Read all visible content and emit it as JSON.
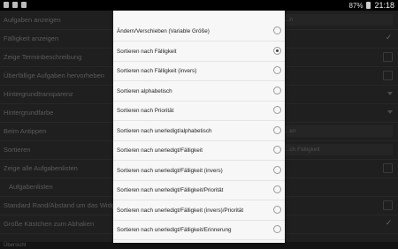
{
  "statusbar": {
    "battery": "87%",
    "time": "21:18"
  },
  "settings_rows": [
    {
      "label": "Aufgaben anzeigen",
      "control": "field",
      "field_value": "...n"
    },
    {
      "label": "Fälligkeit anzeigen",
      "control": "check_on"
    },
    {
      "label": "Zeige Terminbeschreibung",
      "control": "check"
    },
    {
      "label": "Überfällige Aufgaben hervorheben",
      "control": "check"
    },
    {
      "label": "Hintergrundtransparenz",
      "control": "dropdown"
    },
    {
      "label": "Hintergrundfarbe",
      "control": "dropdown"
    },
    {
      "label": "Beim Antippen",
      "control": "field",
      "field_value": "...en"
    },
    {
      "label": "Sortieren",
      "control": "field",
      "field_value": "...ch Fälligkeit"
    },
    {
      "label": "Zeige alle Aufgabenlisten",
      "control": "check"
    },
    {
      "label": "Aufgabenlisten",
      "control": "none"
    },
    {
      "label": "Standard Rand/Abstand um das Widget heru...",
      "control": "check"
    },
    {
      "label": "Große Kästchen zum Abhaken",
      "control": "check_on"
    }
  ],
  "footer_text": "Übersicht",
  "dialog": {
    "options": [
      {
        "label": "Ändern/Verschieben (Variable Größe)",
        "selected": false
      },
      {
        "label": "Sortieren nach Fälligkeit",
        "selected": true
      },
      {
        "label": "Sortieren nach Fälligkeit (invers)",
        "selected": false
      },
      {
        "label": "Sortieren alphabetisch",
        "selected": false
      },
      {
        "label": "Sortieren nach Priorität",
        "selected": false
      },
      {
        "label": "Sortieren nach unerledigt/alphabetisch",
        "selected": false
      },
      {
        "label": "Sortieren nach unerledigt/Fälligkeit",
        "selected": false
      },
      {
        "label": "Sortieren nach unerledigt/Fälligkeit (invers)",
        "selected": false
      },
      {
        "label": "Sortieren nach unerledigt/Fälligkeit/Priorität",
        "selected": false
      },
      {
        "label": "Sortieren nach unerledigt/Fälligkeit (invers)/Priorität",
        "selected": false
      },
      {
        "label": "Sortieren nach unerledigt/Fälligkeit/Erinnerung",
        "selected": false
      }
    ]
  }
}
